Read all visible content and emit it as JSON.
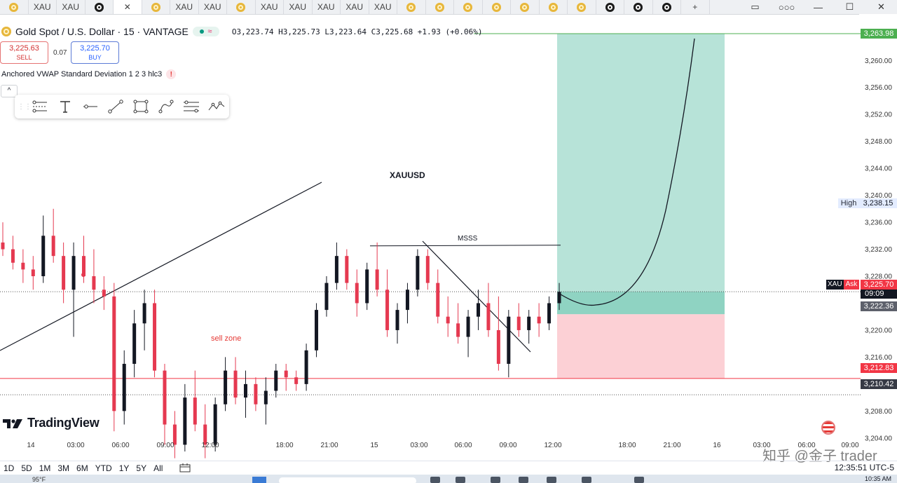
{
  "tabs": [
    {
      "icon": "gold-coin-icon",
      "label": ""
    },
    {
      "icon": "",
      "label": "XAU"
    },
    {
      "icon": "",
      "label": "XAU"
    },
    {
      "icon": "bulb-icon",
      "label": ""
    },
    {
      "icon": "close-icon",
      "label": "✕"
    },
    {
      "icon": "gold-coin-icon",
      "label": ""
    },
    {
      "icon": "",
      "label": "XAU"
    },
    {
      "icon": "",
      "label": "XAU"
    },
    {
      "icon": "gold-coin-icon",
      "label": ""
    },
    {
      "icon": "",
      "label": "XAU"
    },
    {
      "icon": "",
      "label": "XAU"
    },
    {
      "icon": "",
      "label": "XAU"
    },
    {
      "icon": "",
      "label": "XAU"
    },
    {
      "icon": "",
      "label": "XAU"
    },
    {
      "icon": "gold-coin-icon",
      "label": ""
    },
    {
      "icon": "gold-coin-icon",
      "label": ""
    },
    {
      "icon": "gold-coin-icon",
      "label": ""
    },
    {
      "icon": "gold-coin-icon",
      "label": ""
    },
    {
      "icon": "gold-coin-icon",
      "label": ""
    },
    {
      "icon": "gold-coin-icon",
      "label": ""
    },
    {
      "icon": "gold-coin-icon",
      "label": ""
    },
    {
      "icon": "bulb-icon",
      "label": ""
    },
    {
      "icon": "bulb-icon",
      "label": ""
    },
    {
      "icon": "bulb-icon",
      "label": ""
    },
    {
      "icon": "plus-icon",
      "label": "+"
    }
  ],
  "window_controls": {
    "layout": "▭",
    "more": "○○○",
    "minimize": "—",
    "maximize": "☐",
    "close": "✕"
  },
  "header": {
    "symbol": "Gold Spot / U.S. Dollar · 15 · VANTAGE",
    "ohlc": "O3,223.74 H3,225.73 L3,223.64 C3,225.68 +1.93 (+0.06%)",
    "sell_price": "3,225.63",
    "sell_label": "SELL",
    "spread": "0.07",
    "buy_price": "3,225.70",
    "buy_label": "BUY",
    "indicator": "Anchored VWAP Standard Deviation 1 2 3 hlc3",
    "indicator_warn": "!",
    "collapse": "^"
  },
  "drawing_tools": [
    "trend-angle-icon",
    "text-icon",
    "horizontal-line-icon",
    "trend-line-icon",
    "rectangle-icon",
    "curve-icon",
    "fib-retracement-icon",
    "pattern-icon"
  ],
  "annotations": {
    "title": "XAUUSD",
    "msss": "MSSS",
    "sell_zone": "sell zone"
  },
  "price_axis": {
    "ticks": [
      "3,260.00",
      "3,256.00",
      "3,252.00",
      "3,248.00",
      "3,244.00",
      "3,240.00",
      "3,236.00",
      "3,232.00",
      "3,228.00",
      "3,220.00",
      "3,216.00",
      "3,208.00",
      "3,204.00"
    ],
    "target_tag": "3,263.98",
    "high_label": "High",
    "high_value": "3,238.15",
    "ask_symbol": "XAU",
    "ask_label": "Ask",
    "ask_value": "3,225.70",
    "countdown": "09:09",
    "entry_tag": "3,222.36",
    "stop_tag": "3,212.83",
    "low_tag": "3,210.42"
  },
  "time_axis": [
    "14",
    "03:00",
    "06:00",
    "09:00",
    "12:00",
    "18:00",
    "21:00",
    "15",
    "03:00",
    "06:00",
    "09:00",
    "12:00",
    "18:00",
    "21:00",
    "16",
    "03:00",
    "06:00",
    "09:00"
  ],
  "bottom": {
    "ranges": [
      "1D",
      "5D",
      "1M",
      "3M",
      "6M",
      "YTD",
      "1Y",
      "5Y",
      "All"
    ],
    "clock": "12:35:51 UTC-5",
    "logo": "TradingView",
    "watermark": "知乎 @金子 trader"
  },
  "taskbar": {
    "temp": "95°F",
    "time": "10:35 AM"
  },
  "colors": {
    "up": "#131722",
    "down": "#e53950",
    "tp_zone": "#b7e3d8",
    "sl_zone": "#fcd0d5",
    "target_line": "#4caf50",
    "stop_line": "#f23645",
    "accent": "#2962ff"
  },
  "chart_data": {
    "type": "candlestick",
    "symbol": "XAUUSD",
    "timeframe": "15",
    "ylim": [
      3203,
      3266
    ],
    "x": [
      "14",
      "03:00",
      "06:00",
      "09:00",
      "12:00",
      "18:00",
      "21:00",
      "15",
      "03:00",
      "06:00",
      "09:00",
      "12:00",
      "18:00",
      "21:00",
      "16",
      "03:00",
      "06:00",
      "09:00"
    ],
    "candles": [
      [
        3233,
        3236,
        3231,
        3232
      ],
      [
        3232,
        3234,
        3229,
        3230
      ],
      [
        3230,
        3232,
        3227,
        3229
      ],
      [
        3229,
        3231,
        3226,
        3228
      ],
      [
        3228,
        3237,
        3227,
        3234
      ],
      [
        3234,
        3238,
        3230,
        3231
      ],
      [
        3231,
        3233,
        3224,
        3226
      ],
      [
        3226,
        3233,
        3219,
        3231
      ],
      [
        3231,
        3234,
        3227,
        3228
      ],
      [
        3228,
        3232,
        3224,
        3226
      ],
      [
        3226,
        3228,
        3223,
        3225
      ],
      [
        3225,
        3227,
        3205,
        3208
      ],
      [
        3208,
        3217,
        3206,
        3215
      ],
      [
        3215,
        3223,
        3213,
        3221
      ],
      [
        3221,
        3226,
        3217,
        3224
      ],
      [
        3224,
        3226,
        3213,
        3214
      ],
      [
        3214,
        3215,
        3203,
        3206
      ],
      [
        3206,
        3208,
        3201,
        3203
      ],
      [
        3203,
        3212,
        3202,
        3210
      ],
      [
        3210,
        3214,
        3205,
        3206
      ],
      [
        3206,
        3209,
        3201,
        3203
      ],
      [
        3203,
        3210,
        3202,
        3209
      ],
      [
        3209,
        3216,
        3208,
        3214
      ],
      [
        3214,
        3216,
        3209,
        3210
      ],
      [
        3210,
        3214,
        3207,
        3212
      ],
      [
        3212,
        3213,
        3208,
        3209
      ],
      [
        3209,
        3213,
        3206,
        3211
      ],
      [
        3211,
        3215,
        3210,
        3214
      ],
      [
        3214,
        3215,
        3211,
        3213
      ],
      [
        3213,
        3214,
        3211,
        3212
      ],
      [
        3212,
        3218,
        3211,
        3217
      ],
      [
        3217,
        3224,
        3216,
        3223
      ],
      [
        3223,
        3228,
        3222,
        3227
      ],
      [
        3227,
        3233,
        3226,
        3231
      ],
      [
        3231,
        3232,
        3226,
        3227
      ],
      [
        3227,
        3229,
        3222,
        3224
      ],
      [
        3224,
        3230,
        3223,
        3229
      ],
      [
        3229,
        3233,
        3225,
        3226
      ],
      [
        3226,
        3229,
        3219,
        3220
      ],
      [
        3220,
        3224,
        3218,
        3223
      ],
      [
        3223,
        3227,
        3221,
        3226
      ],
      [
        3226,
        3232,
        3225,
        3231
      ],
      [
        3231,
        3232,
        3226,
        3227
      ],
      [
        3227,
        3229,
        3221,
        3222
      ],
      [
        3222,
        3225,
        3219,
        3221
      ],
      [
        3221,
        3224,
        3218,
        3219
      ],
      [
        3219,
        3223,
        3216,
        3222
      ],
      [
        3222,
        3226,
        3220,
        3224
      ],
      [
        3224,
        3227,
        3219,
        3220
      ],
      [
        3220,
        3225,
        3214,
        3215
      ],
      [
        3215,
        3223,
        3213,
        3222
      ],
      [
        3222,
        3224,
        3219,
        3220
      ],
      [
        3220,
        3223,
        3218,
        3222
      ],
      [
        3222,
        3224,
        3219,
        3221
      ],
      [
        3221,
        3225,
        3220,
        3224
      ],
      [
        3224,
        3227,
        3223,
        3225.68
      ]
    ],
    "drawings": {
      "tp_level": 3263.98,
      "entry_level": 3222.36,
      "stop_level": 3212.83,
      "horizontal_low": 3210.42,
      "ask": 3225.7,
      "msss_level": 3232.5
    },
    "grid": false
  }
}
